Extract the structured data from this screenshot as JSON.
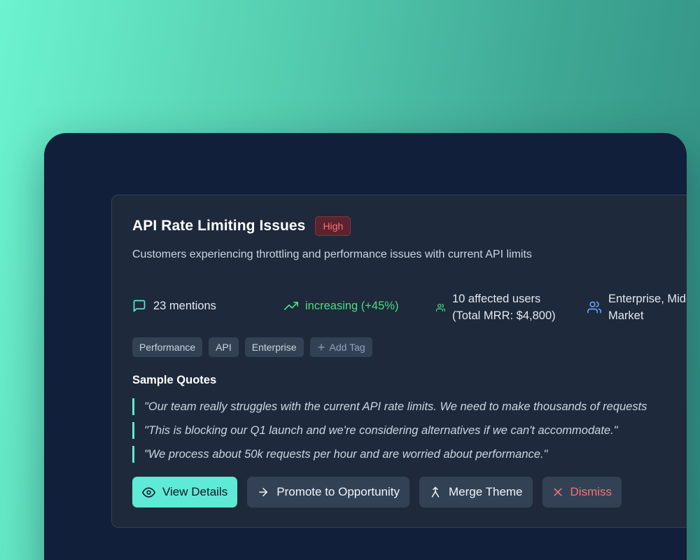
{
  "theme": {
    "title": "API Rate Limiting Issues",
    "priority": "High",
    "description": "Customers experiencing throttling and performance issues with current API limits"
  },
  "stats": {
    "mentions": {
      "label": "23 mentions",
      "icon": "message-square-icon"
    },
    "trend": {
      "label": "increasing (+45%)",
      "icon": "trending-up-icon"
    },
    "users": {
      "line1": "10 affected users",
      "line2": "(Total MRR: $4,800)",
      "icon": "users-icon"
    },
    "segment": {
      "line1": "Enterprise, Mid-",
      "line2": "Market",
      "icon": "users-icon"
    }
  },
  "tags": {
    "items": [
      "Performance",
      "API",
      "Enterprise"
    ],
    "add_label": "Add Tag"
  },
  "quotes": {
    "heading": "Sample Quotes",
    "items": [
      "\"Our team really struggles with the current API rate limits. We need to make thousands of requests",
      "\"This is blocking our Q1 launch and we're considering alternatives if we can't accommodate.\"",
      "\"We process about 50k requests per hour and are worried about performance.\""
    ]
  },
  "actions": {
    "view_details": "View Details",
    "promote": "Promote to Opportunity",
    "merge": "Merge Theme",
    "dismiss": "Dismiss"
  },
  "colors": {
    "accent": "#5eead4",
    "card_bg": "#1e293b",
    "shell_bg": "#111f3a",
    "high_badge": "#f87171",
    "trend_up": "#4ade80",
    "segment_icon": "#60a5fa"
  }
}
